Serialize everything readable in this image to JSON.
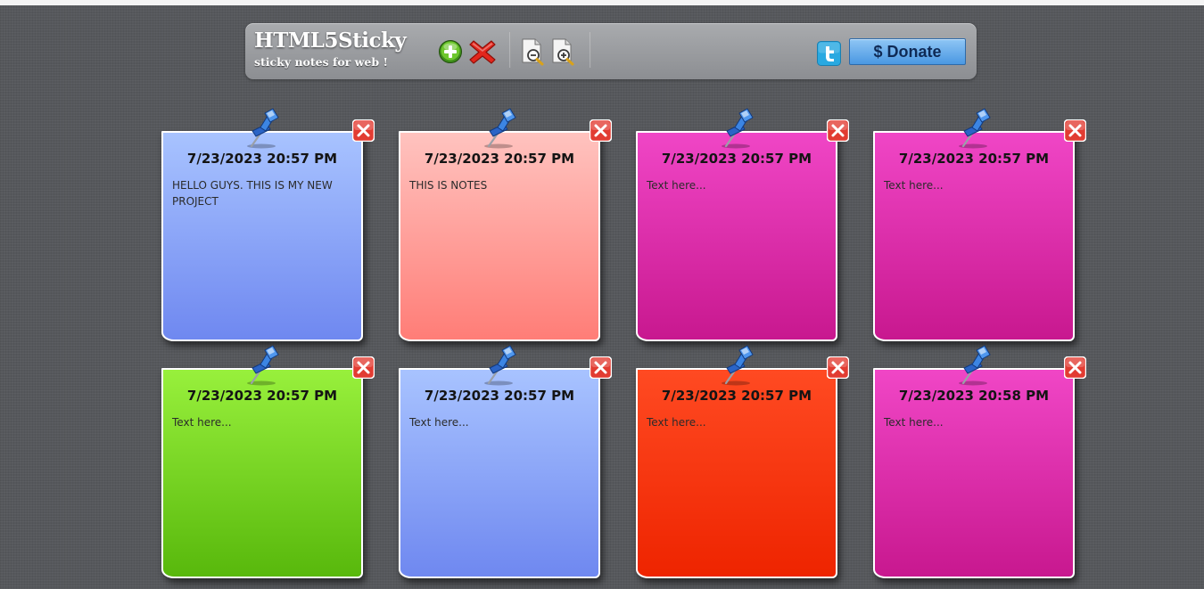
{
  "app": {
    "title": "HTML5Sticky",
    "subtitle": "sticky notes for web !"
  },
  "toolbar": {
    "add_icon": "add-note-icon",
    "delete_icon": "delete-all-icon",
    "zoom_out_icon": "zoom-out-icon",
    "zoom_in_icon": "zoom-in-icon",
    "twitter_icon": "twitter-icon",
    "donate_label": "$ Donate"
  },
  "notes": [
    {
      "date": "7/23/2023 20:57 PM",
      "text": "HELLO GUYS. THIS IS MY NEW PROJECT",
      "color_top": "#a8c3ff",
      "color_bottom": "#6f88f0"
    },
    {
      "date": "7/23/2023 20:57 PM",
      "text": "THIS IS NOTES",
      "color_top": "#ffc3bf",
      "color_bottom": "#ff7d77"
    },
    {
      "date": "7/23/2023 20:57 PM",
      "text": "Text here...",
      "color_top": "#f046c6",
      "color_bottom": "#c8188f"
    },
    {
      "date": "7/23/2023 20:57 PM",
      "text": "Text here...",
      "color_top": "#f046c6",
      "color_bottom": "#c8188f"
    },
    {
      "date": "7/23/2023 20:57 PM",
      "text": "Text here...",
      "color_top": "#98f03c",
      "color_bottom": "#58b80c"
    },
    {
      "date": "7/23/2023 20:57 PM",
      "text": "Text here...",
      "color_top": "#a8c3ff",
      "color_bottom": "#6f88f0"
    },
    {
      "date": "7/23/2023 20:57 PM",
      "text": "Text here...",
      "color_top": "#ff4a22",
      "color_bottom": "#ee2400"
    },
    {
      "date": "7/23/2023 20:58 PM",
      "text": "Text here...",
      "color_top": "#f046c6",
      "color_bottom": "#c8188f"
    }
  ],
  "note_icons": {
    "pin": "pushpin-icon",
    "close": "close-icon"
  }
}
